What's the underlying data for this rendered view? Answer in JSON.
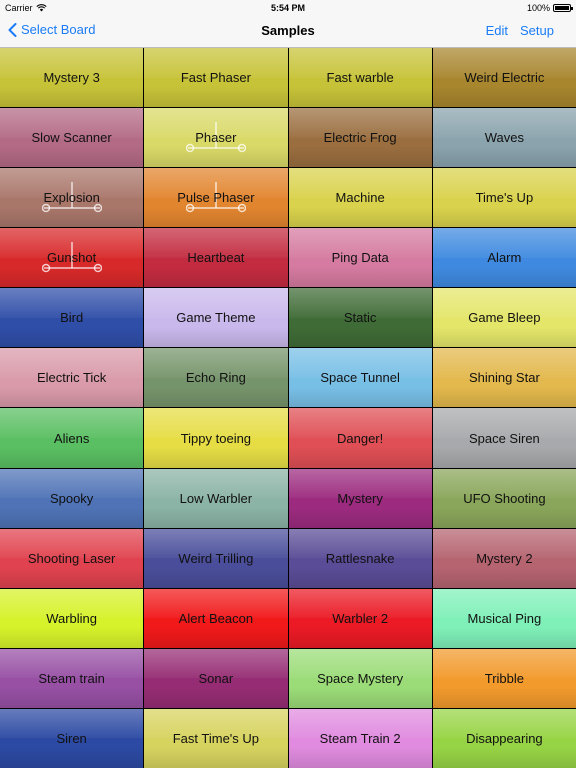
{
  "status_bar": {
    "carrier": "Carrier",
    "time": "5:54 PM",
    "battery": "100%"
  },
  "nav": {
    "back_label": "Select Board",
    "title": "Samples",
    "edit_label": "Edit",
    "setup_label": "Setup"
  },
  "cells": [
    {
      "label": "Mystery 3",
      "color": "#c7c338"
    },
    {
      "label": "Fast Phaser",
      "color": "#c7c338"
    },
    {
      "label": "Fast warble",
      "color": "#c7c338"
    },
    {
      "label": "Weird Electric",
      "color": "#a8862e"
    },
    {
      "label": "Slow Scanner",
      "color": "#b36a85"
    },
    {
      "label": "Phaser",
      "color": "#d9d968",
      "icon": "cart-icon"
    },
    {
      "label": "Electric Frog",
      "color": "#9a6e3f"
    },
    {
      "label": "Waves",
      "color": "#8aa3ad"
    },
    {
      "label": "Explosion",
      "color": "#a9766a",
      "icon": "cart-icon"
    },
    {
      "label": "Pulse Phaser",
      "color": "#e2852f",
      "icon": "cart-icon"
    },
    {
      "label": "Machine",
      "color": "#d9d24c"
    },
    {
      "label": "Time's Up",
      "color": "#d9d24c"
    },
    {
      "label": "Gunshot",
      "color": "#d8292a",
      "icon": "cart-icon"
    },
    {
      "label": "Heartbeat",
      "color": "#c32b40"
    },
    {
      "label": "Ping Data",
      "color": "#d57aa0"
    },
    {
      "label": "Alarm",
      "color": "#3f8ae0"
    },
    {
      "label": "Bird",
      "color": "#2f4ea8"
    },
    {
      "label": "Game Theme",
      "color": "#c9b8ec"
    },
    {
      "label": "Static",
      "color": "#3f6b36"
    },
    {
      "label": "Game Bleep",
      "color": "#e4e66a"
    },
    {
      "label": "Electric Tick",
      "color": "#d99aa9"
    },
    {
      "label": "Echo Ring",
      "color": "#76946b"
    },
    {
      "label": "Space Tunnel",
      "color": "#78bfe6"
    },
    {
      "label": "Shining Star",
      "color": "#e3b84c"
    },
    {
      "label": "Aliens",
      "color": "#5abf62"
    },
    {
      "label": "Tippy toeing",
      "color": "#e6dd45"
    },
    {
      "label": "Danger!",
      "color": "#df4f55"
    },
    {
      "label": "Space Siren",
      "color": "#a8a9ac"
    },
    {
      "label": "Spooky",
      "color": "#4f73b6"
    },
    {
      "label": "Low Warbler",
      "color": "#8bb3a6"
    },
    {
      "label": "Mystery",
      "color": "#9c2b7f"
    },
    {
      "label": "UFO Shooting",
      "color": "#8aa65a"
    },
    {
      "label": "Shooting Laser",
      "color": "#e0434f"
    },
    {
      "label": "Weird Trilling",
      "color": "#4a4e9a"
    },
    {
      "label": "Rattlesnake",
      "color": "#5a4c96"
    },
    {
      "label": "Mystery 2",
      "color": "#b56470"
    },
    {
      "label": "Warbling",
      "color": "#d6f22a"
    },
    {
      "label": "Alert Beacon",
      "color": "#f1191a"
    },
    {
      "label": "Warbler 2",
      "color": "#eb1a25"
    },
    {
      "label": "Musical Ping",
      "color": "#7ff0b8"
    },
    {
      "label": "Steam train",
      "color": "#9750a4"
    },
    {
      "label": "Sonar",
      "color": "#962d74"
    },
    {
      "label": "Space Mystery",
      "color": "#9bdc78"
    },
    {
      "label": "Tribble",
      "color": "#f29a2c"
    },
    {
      "label": "Siren",
      "color": "#2c4aa3"
    },
    {
      "label": "Fast Time's Up",
      "color": "#d7d35f"
    },
    {
      "label": "Steam Train 2",
      "color": "#e08bdf"
    },
    {
      "label": "Disappearing",
      "color": "#97d445"
    }
  ]
}
